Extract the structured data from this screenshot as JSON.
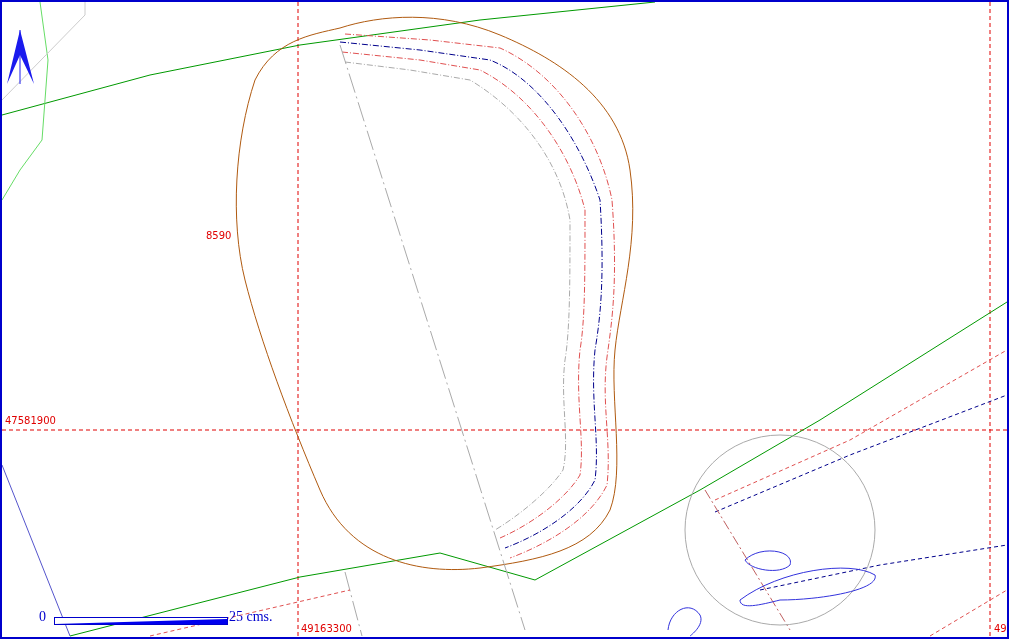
{
  "map": {
    "contour_label": "8590",
    "y_grid_label": "47581900",
    "x_grid_labels": [
      "49163300",
      "49"
    ]
  },
  "scale_bar": {
    "start": "0",
    "end": "25 cms."
  }
}
